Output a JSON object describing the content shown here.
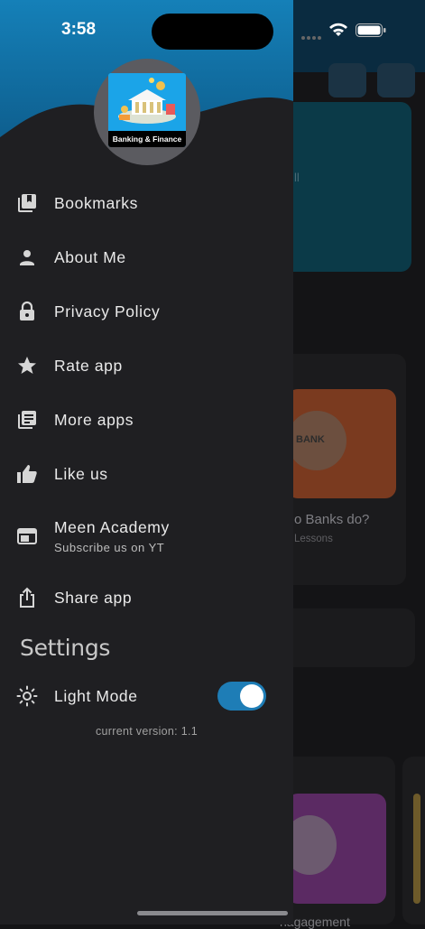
{
  "status_bar": {
    "time": "3:58"
  },
  "app": {
    "logo_caption": "Banking & Finance"
  },
  "menu": {
    "items": [
      {
        "id": "bookmarks",
        "label": "Bookmarks",
        "icon": "bookmarks-icon"
      },
      {
        "id": "about",
        "label": "About Me",
        "icon": "person-icon"
      },
      {
        "id": "privacy",
        "label": "Privacy Policy",
        "icon": "lock-icon"
      },
      {
        "id": "rate",
        "label": "Rate app",
        "icon": "star-icon"
      },
      {
        "id": "more",
        "label": "More apps",
        "icon": "library-icon"
      },
      {
        "id": "like",
        "label": "Like us",
        "icon": "thumbs-up-icon"
      },
      {
        "id": "academy",
        "label": "Meen Academy",
        "sublabel": "Subscribe us on YT",
        "icon": "web-window-icon"
      },
      {
        "id": "share",
        "label": "Share app",
        "icon": "share-icon"
      }
    ]
  },
  "settings": {
    "heading": "Settings",
    "light_mode_label": "Light Mode",
    "light_mode_on": true,
    "version_text": "current version: 1.1"
  },
  "background": {
    "fragment_all": "ll",
    "fragment_banks": "o Banks do?",
    "fragment_lessons": "Lessons",
    "fragment_bank_badge": "BANK",
    "fragment_management": "nagagement"
  },
  "colors": {
    "drawer_bg": "#1f1f22",
    "header_blue": "#1170a7",
    "accent": "#1e7db6"
  }
}
